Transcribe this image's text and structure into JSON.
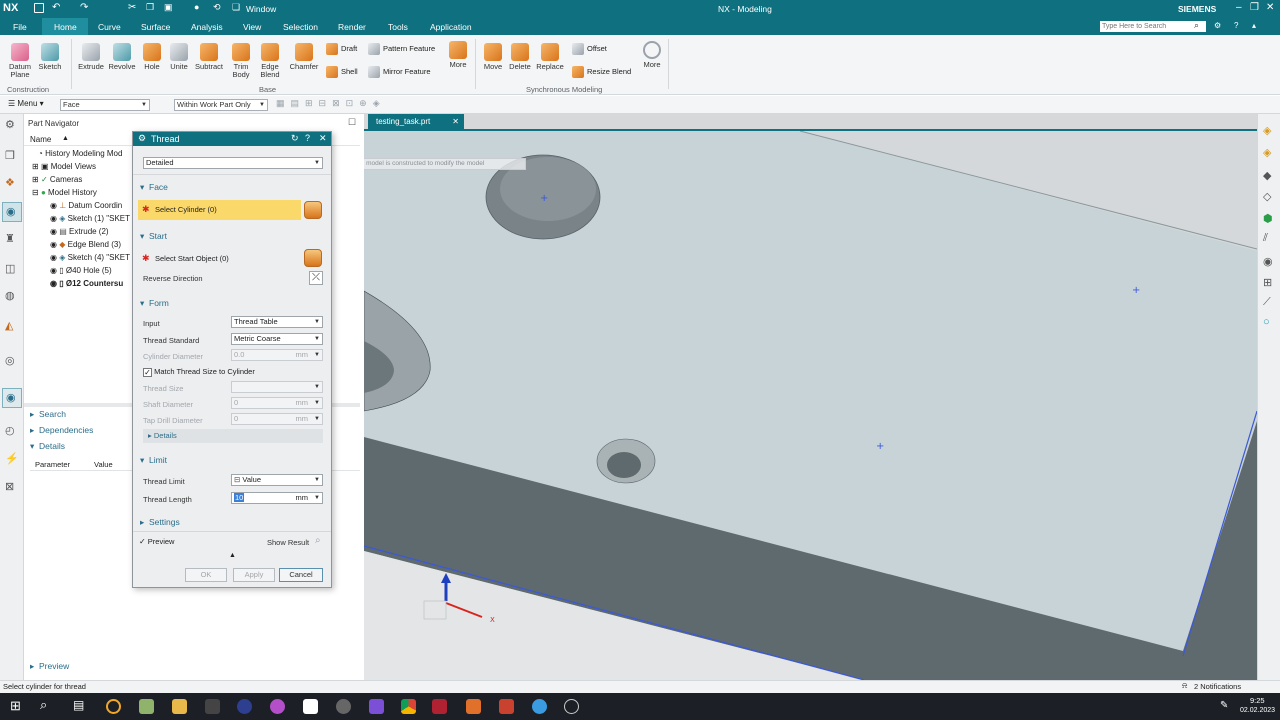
{
  "titlebar": {
    "app_logo": "NX",
    "window_menu": "Window",
    "title": "NX - Modeling",
    "brand": "SIEMENS"
  },
  "menubar": {
    "items": [
      "File",
      "Home",
      "Curve",
      "Surface",
      "Analysis",
      "View",
      "Selection",
      "Render",
      "Tools",
      "Application"
    ],
    "active": "Home",
    "search_placeholder": "Type Here to Search"
  },
  "ribbon": {
    "construction": {
      "label": "Construction",
      "buttons": [
        "Datum Plane",
        "Sketch"
      ]
    },
    "base": {
      "label": "Base",
      "buttons": [
        "Extrude",
        "Revolve",
        "Hole",
        "Unite",
        "Subtract",
        "Trim Body",
        "Edge Blend",
        "Chamfer"
      ],
      "small": [
        "Draft",
        "Shell",
        "Pattern Feature",
        "Mirror Feature"
      ],
      "more": "More"
    },
    "sync": {
      "label": "Synchronous Modeling",
      "buttons": [
        "Move",
        "Delete",
        "Replace"
      ],
      "small": [
        "Offset",
        "Resize Blend"
      ],
      "more": "More"
    }
  },
  "toolbar2": {
    "menu_label": "Menu",
    "filter_value": "Face",
    "scope_value": "Within Work Part Only"
  },
  "navigator": {
    "title": "Part Navigator",
    "column_name": "Name",
    "rows": [
      "History Modeling Mod",
      "Model Views",
      "Cameras",
      "Model History",
      "Datum Coordin",
      "Sketch (1) \"SKET",
      "Extrude (2)",
      "Edge Blend (3)",
      "Sketch (4) \"SKET",
      "Ø40 Hole (5)",
      "Ø12 Countersu"
    ],
    "search": "Search",
    "dependencies": "Dependencies",
    "details": "Details",
    "details_cols": [
      "Parameter",
      "Value"
    ],
    "preview": "Preview"
  },
  "viewport": {
    "tab_label": "testing_task.prt",
    "hint": "A 3D thread model is constructed to modify the model"
  },
  "dialog": {
    "title": "Thread",
    "mode_value": "Detailed",
    "face": {
      "header": "Face",
      "select_label": "Select Cylinder (0)"
    },
    "start": {
      "header": "Start",
      "select_label": "Select Start Object (0)",
      "reverse_label": "Reverse Direction"
    },
    "form": {
      "header": "Form",
      "input_label": "Input",
      "input_value": "Thread Table",
      "standard_label": "Thread Standard",
      "standard_value": "Metric Coarse",
      "cyl_diam_label": "Cylinder Diameter",
      "cyl_diam_value": "0.0",
      "cyl_diam_unit": "mm",
      "match_label": "Match Thread Size to Cylinder",
      "match_checked": true,
      "size_label": "Thread Size",
      "shaft_label": "Shaft Diameter",
      "shaft_value": "0",
      "shaft_unit": "mm",
      "tap_label": "Tap Drill Diameter",
      "tap_value": "0",
      "tap_unit": "mm",
      "details_label": "Details"
    },
    "limit": {
      "header": "Limit",
      "limit_label": "Thread Limit",
      "limit_value": "Value",
      "length_label": "Thread Length",
      "length_value": "10",
      "length_unit": "mm"
    },
    "settings": {
      "header": "Settings"
    },
    "preview_label": "Preview",
    "show_result": "Show Result",
    "ok": "OK",
    "apply": "Apply",
    "cancel": "Cancel"
  },
  "statusbar": {
    "left": "Select cylinder for thread",
    "notifications": "2 Notifications"
  },
  "taskbar": {
    "time": "9:25",
    "date": "02.02.2023"
  },
  "colors": {
    "teal": "#0f7180",
    "select_yellow": "#fbd86a",
    "face_light": "#c6d2d6",
    "face_dark": "#5d686c"
  }
}
